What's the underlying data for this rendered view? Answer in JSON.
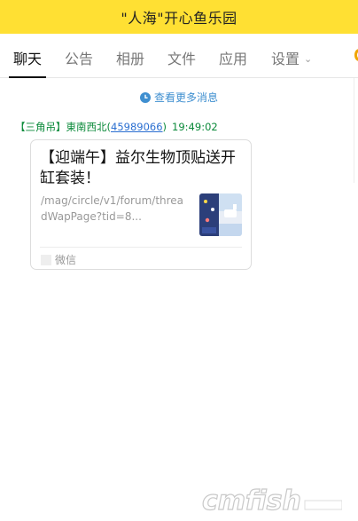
{
  "window": {
    "title": "\"人海\"开心鱼乐园"
  },
  "tabs": [
    {
      "label": "聊天",
      "active": true
    },
    {
      "label": "公告"
    },
    {
      "label": "相册"
    },
    {
      "label": "文件"
    },
    {
      "label": "应用"
    },
    {
      "label": "设置"
    }
  ],
  "chat": {
    "more_label": "查看更多消息",
    "message": {
      "sender_name": "【三角吊】東南西北",
      "sender_id_open": "(",
      "sender_id": "45989066",
      "sender_id_close": ")",
      "time": "19:49:02",
      "card": {
        "title": "【迎端午】益尔生物顶贴送开缸套装！",
        "description": "/mag/circle/v1/forum/threadWapPage?tid=8...",
        "source": "微信"
      }
    }
  },
  "watermark": {
    "text": "cmfish"
  },
  "colors": {
    "title_bar": "#ffe033",
    "link_blue": "#3f8fd0",
    "sender_green": "#0b8a3a",
    "phone_icon": "#f0a500"
  }
}
